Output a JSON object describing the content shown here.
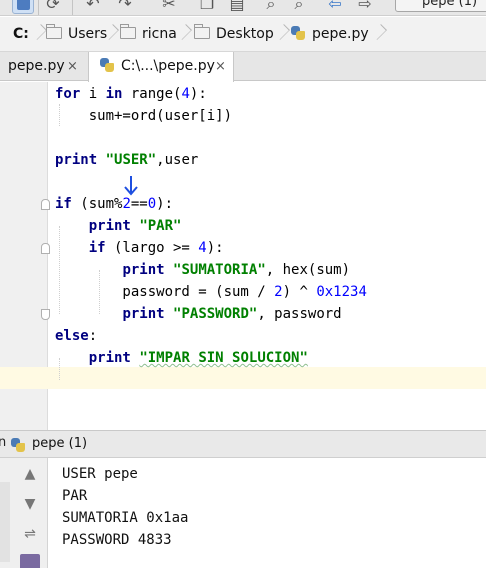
{
  "toolbar": {
    "run_config_label": "pepe (1)"
  },
  "breadcrumb": {
    "drive": "C:",
    "items": [
      "Users",
      "ricna",
      "Desktop"
    ],
    "file": "pepe.py"
  },
  "tabs": [
    {
      "label": "pepe.py",
      "close": "×"
    },
    {
      "label": "C:\\...\\pepe.py",
      "close": "×"
    }
  ],
  "editor": {
    "lines": [
      {
        "segments": [
          {
            "t": "for",
            "c": "kw"
          },
          {
            "t": " i ",
            "c": ""
          },
          {
            "t": "in",
            "c": "kw"
          },
          {
            "t": " range(",
            "c": ""
          },
          {
            "t": "4",
            "c": "num"
          },
          {
            "t": "):",
            "c": ""
          }
        ]
      },
      {
        "segments": [
          {
            "t": "    sum+=ord(user[i])",
            "c": ""
          }
        ]
      },
      {
        "segments": []
      },
      {
        "segments": [
          {
            "t": "print",
            "c": "kw"
          },
          {
            "t": " ",
            "c": ""
          },
          {
            "t": "\"USER\"",
            "c": "str"
          },
          {
            "t": ",user",
            "c": ""
          }
        ]
      },
      {
        "segments": []
      },
      {
        "segments": [
          {
            "t": "if",
            "c": "kw"
          },
          {
            "t": " (sum%",
            "c": ""
          },
          {
            "t": "2",
            "c": "num"
          },
          {
            "t": "==",
            "c": ""
          },
          {
            "t": "0",
            "c": "num"
          },
          {
            "t": "):",
            "c": ""
          }
        ]
      },
      {
        "segments": [
          {
            "t": "    ",
            "c": ""
          },
          {
            "t": "print",
            "c": "kw"
          },
          {
            "t": " ",
            "c": ""
          },
          {
            "t": "\"PAR\"",
            "c": "str"
          }
        ]
      },
      {
        "segments": [
          {
            "t": "    ",
            "c": ""
          },
          {
            "t": "if",
            "c": "kw"
          },
          {
            "t": " (largo >= ",
            "c": ""
          },
          {
            "t": "4",
            "c": "num"
          },
          {
            "t": "):",
            "c": ""
          }
        ]
      },
      {
        "segments": [
          {
            "t": "        ",
            "c": ""
          },
          {
            "t": "print",
            "c": "kw"
          },
          {
            "t": " ",
            "c": ""
          },
          {
            "t": "\"SUMATORIA\"",
            "c": "str"
          },
          {
            "t": ", hex(sum)",
            "c": ""
          }
        ]
      },
      {
        "segments": [
          {
            "t": "        password = (sum / ",
            "c": ""
          },
          {
            "t": "2",
            "c": "num"
          },
          {
            "t": ") ^ ",
            "c": ""
          },
          {
            "t": "0x1234",
            "c": "num"
          }
        ]
      },
      {
        "segments": [
          {
            "t": "        ",
            "c": ""
          },
          {
            "t": "print",
            "c": "kw"
          },
          {
            "t": " ",
            "c": ""
          },
          {
            "t": "\"PASSWORD\"",
            "c": "str"
          },
          {
            "t": ", password",
            "c": ""
          }
        ]
      },
      {
        "segments": [
          {
            "t": "else",
            "c": "kw"
          },
          {
            "t": ":",
            "c": ""
          }
        ]
      },
      {
        "segments": [
          {
            "t": "    ",
            "c": ""
          },
          {
            "t": "print",
            "c": "kw"
          },
          {
            "t": " ",
            "c": ""
          },
          {
            "t": "\"IMPAR SIN SOLUCION\"",
            "c": "str"
          }
        ]
      }
    ]
  },
  "run_panel": {
    "prefix": "n",
    "title": "pepe (1)",
    "output": [
      "USER pepe",
      "PAR",
      "SUMATORIA 0x1aa",
      "PASSWORD 4833"
    ]
  },
  "colors": {
    "keyword": "#000080",
    "string": "#008000",
    "number": "#0000ff",
    "caret_line": "#fffae3"
  },
  "icons": [
    "save-icon",
    "sync-icon",
    "undo-icon",
    "redo-icon",
    "back-icon",
    "forward-icon",
    "folder-icon",
    "python-file-icon",
    "close-icon",
    "rerun-icon",
    "stop-icon",
    "soft-wrap-icon",
    "down-arrow-annotation-icon"
  ]
}
